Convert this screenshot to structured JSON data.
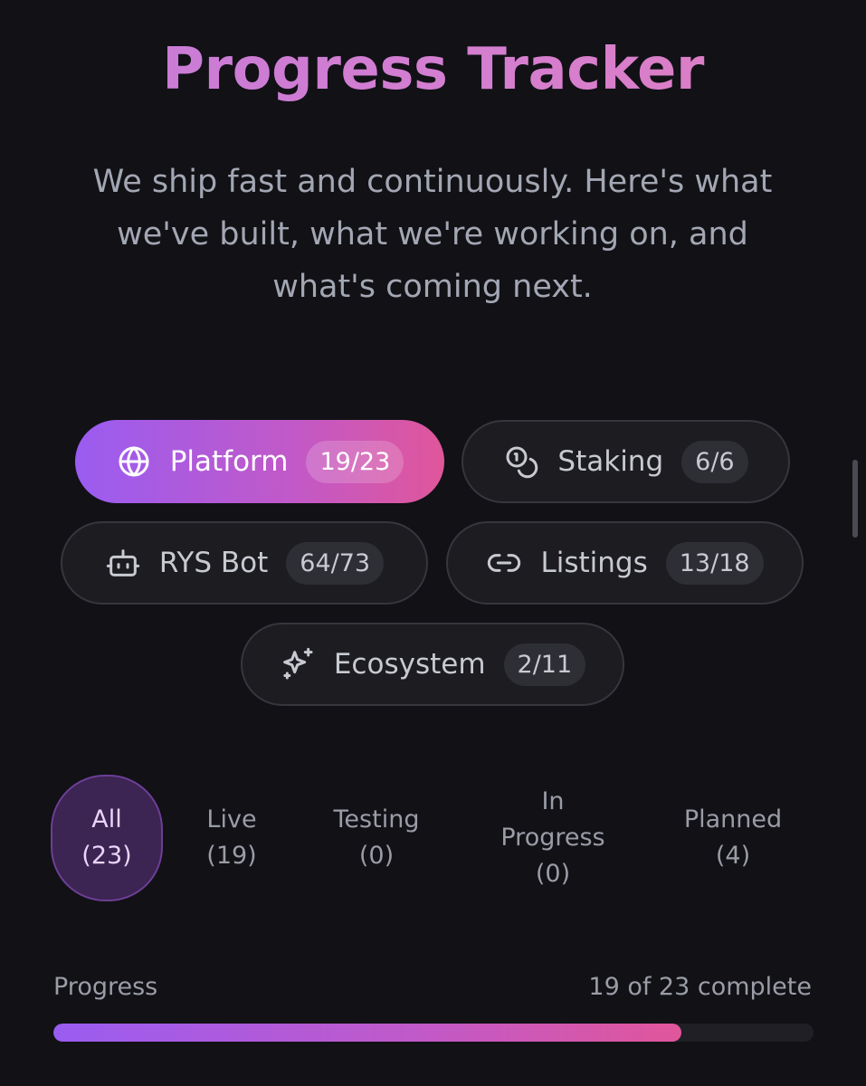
{
  "header": {
    "title": "Progress Tracker",
    "subtitle": "We ship fast and continuously. Here's what we've built, what we're working on, and what's coming next."
  },
  "categories": [
    {
      "label": "Platform",
      "count": "19/23",
      "icon": "globe-icon",
      "active": true
    },
    {
      "label": "Staking",
      "count": "6/6",
      "icon": "coins-icon",
      "active": false
    },
    {
      "label": "RYS Bot",
      "count": "64/73",
      "icon": "bot-icon",
      "active": false
    },
    {
      "label": "Listings",
      "count": "13/18",
      "icon": "link-icon",
      "active": false
    },
    {
      "label": "Ecosystem",
      "count": "2/11",
      "icon": "sparkles-icon",
      "active": false
    }
  ],
  "filters": [
    {
      "label": "All",
      "count": "(23)",
      "active": true
    },
    {
      "label": "Live",
      "count": "(19)",
      "active": false
    },
    {
      "label": "Testing",
      "count": "(0)",
      "active": false
    },
    {
      "label": "In",
      "label2": "Progress",
      "count": "(0)",
      "active": false
    },
    {
      "label": "Planned",
      "count": "(4)",
      "active": false
    }
  ],
  "progress": {
    "label": "Progress",
    "summary": "19 of 23 complete",
    "fraction": 0.826
  },
  "colors": {
    "background": "#111116",
    "accent_start": "#9a5cf1",
    "accent_end": "#e0569a",
    "active_filter": "#3c2453"
  }
}
